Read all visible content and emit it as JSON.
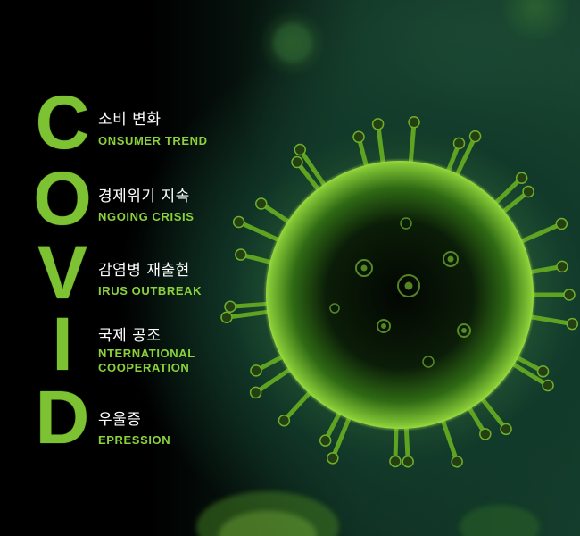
{
  "entries": [
    {
      "letter": "C",
      "korean": "소비 변화",
      "english": "ONSUMER TREND"
    },
    {
      "letter": "O",
      "korean": "경제위기 지속",
      "english": "NGOING CRISIS"
    },
    {
      "letter": "V",
      "korean": "감염병 재출현",
      "english": "IRUS OUTBREAK"
    },
    {
      "letter": "I",
      "korean": "국제 공조",
      "english_line1": "NTERNATIONAL",
      "english_line2": "COOPERATION"
    },
    {
      "letter": "D",
      "korean": "우울증",
      "english": "EPRESSION"
    }
  ],
  "colors": {
    "accent": "#7cc233",
    "text": "#ffffff",
    "background": "#000000",
    "virus": "#4e9a20"
  },
  "image": {
    "subject": "virus-illustration"
  }
}
